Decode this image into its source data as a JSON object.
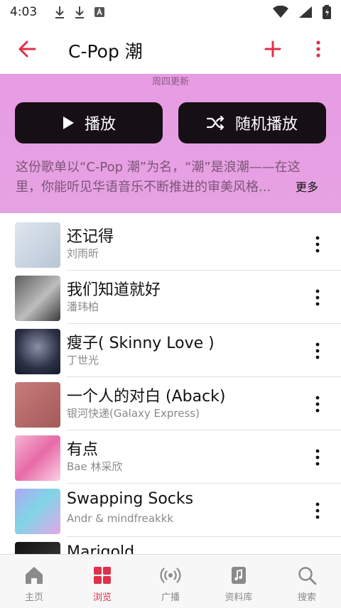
{
  "status_bar": {
    "time": "4:03"
  },
  "app_bar": {
    "title": "C-Pop 潮"
  },
  "header": {
    "updated": "周四更新",
    "play_label": "播放",
    "shuffle_label": "随机播放",
    "description": "这份歌单以“C-Pop 潮”为名，“潮”是浪潮——在这里，你能听见华语音乐不断推进的审美风格...",
    "more_label": "更多"
  },
  "tracks": [
    {
      "title": "还记得",
      "artist": "刘雨昕"
    },
    {
      "title": "我们知道就好",
      "artist": "潘玮柏"
    },
    {
      "title": "瘦子( Skinny Love )",
      "artist": "丁世光"
    },
    {
      "title": "一个人的对白 (Aback)",
      "artist": "银河快递(Galaxy Express)"
    },
    {
      "title": "有点",
      "artist": "Bae 林采欣"
    },
    {
      "title": "Swapping Socks",
      "artist": "Andr & mindfreakkk"
    },
    {
      "title": "Marigold",
      "artist": ""
    }
  ],
  "nav": [
    {
      "label": "主页",
      "icon": "home-icon"
    },
    {
      "label": "浏览",
      "icon": "browse-icon"
    },
    {
      "label": "广播",
      "icon": "radio-icon"
    },
    {
      "label": "资料库",
      "icon": "library-icon"
    },
    {
      "label": "搜索",
      "icon": "search-icon"
    }
  ],
  "colors": {
    "accent": "#e0304a",
    "header_bg": "#e79ce3",
    "button_bg": "#160f16"
  }
}
